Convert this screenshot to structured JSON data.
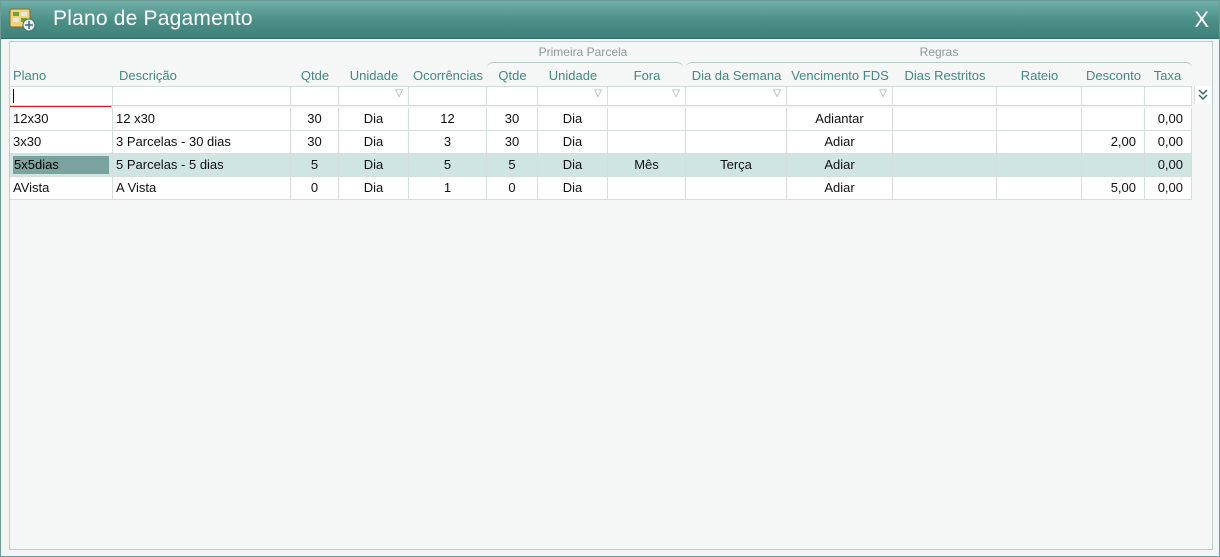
{
  "window": {
    "title": "Plano de Pagamento",
    "close_label": "X",
    "app_icon": "calculator-money-icon"
  },
  "header": {
    "bands": {
      "primeira_parcela": "Primeira Parcela",
      "regras": "Regras"
    },
    "columns": {
      "plano": "Plano",
      "descricao": "Descrição",
      "qtde": "Qtde",
      "unidade": "Unidade",
      "ocorrencias": "Ocorrências",
      "pp_qtde": "Qtde",
      "pp_unidade": "Unidade",
      "fora": "Fora",
      "dia_semana": "Dia da Semana",
      "vencimento_fds": "Vencimento FDS",
      "dias_restritos": "Dias Restritos",
      "rateio": "Rateio",
      "desconto": "Desconto",
      "taxa": "Taxa"
    }
  },
  "filter": {
    "plano_value": "",
    "filter_icon": "filter-triangle-icon",
    "expand_icon": "double-chevron-down-icon"
  },
  "rows": [
    {
      "plano": "12x30",
      "descricao": "12 x30",
      "qtde": "30",
      "unidade": "Dia",
      "ocorrencias": "12",
      "pp_qtde": "30",
      "pp_unidade": "Dia",
      "fora": "",
      "dia_semana": "",
      "vencimento_fds": "Adiantar",
      "dias_restritos": "",
      "rateio": "",
      "desconto": "",
      "taxa": "0,00"
    },
    {
      "plano": "3x30",
      "descricao": "3 Parcelas - 30 dias",
      "qtde": "30",
      "unidade": "Dia",
      "ocorrencias": "3",
      "pp_qtde": "30",
      "pp_unidade": "Dia",
      "fora": "",
      "dia_semana": "",
      "vencimento_fds": "Adiar",
      "dias_restritos": "",
      "rateio": "",
      "desconto": "2,00",
      "taxa": "0,00"
    },
    {
      "plano": "5x5dias",
      "descricao": "5 Parcelas - 5 dias",
      "qtde": "5",
      "unidade": "Dia",
      "ocorrencias": "5",
      "pp_qtde": "5",
      "pp_unidade": "Dia",
      "fora": "Mês",
      "dia_semana": "Terça",
      "vencimento_fds": "Adiar",
      "dias_restritos": "",
      "rateio": "",
      "desconto": "",
      "taxa": "0,00"
    },
    {
      "plano": "AVista",
      "descricao": "A Vista",
      "qtde": "0",
      "unidade": "Dia",
      "ocorrencias": "1",
      "pp_qtde": "0",
      "pp_unidade": "Dia",
      "fora": "",
      "dia_semana": "",
      "vencimento_fds": "Adiar",
      "dias_restritos": "",
      "rateio": "",
      "desconto": "5,00",
      "taxa": "0,00"
    }
  ],
  "selected_row_index": 2,
  "colors": {
    "title_bar": "#4a8e86",
    "header_text": "#3f8a83",
    "selected_row": "#cfe5e1",
    "selected_cell": "#7aa3a0"
  }
}
